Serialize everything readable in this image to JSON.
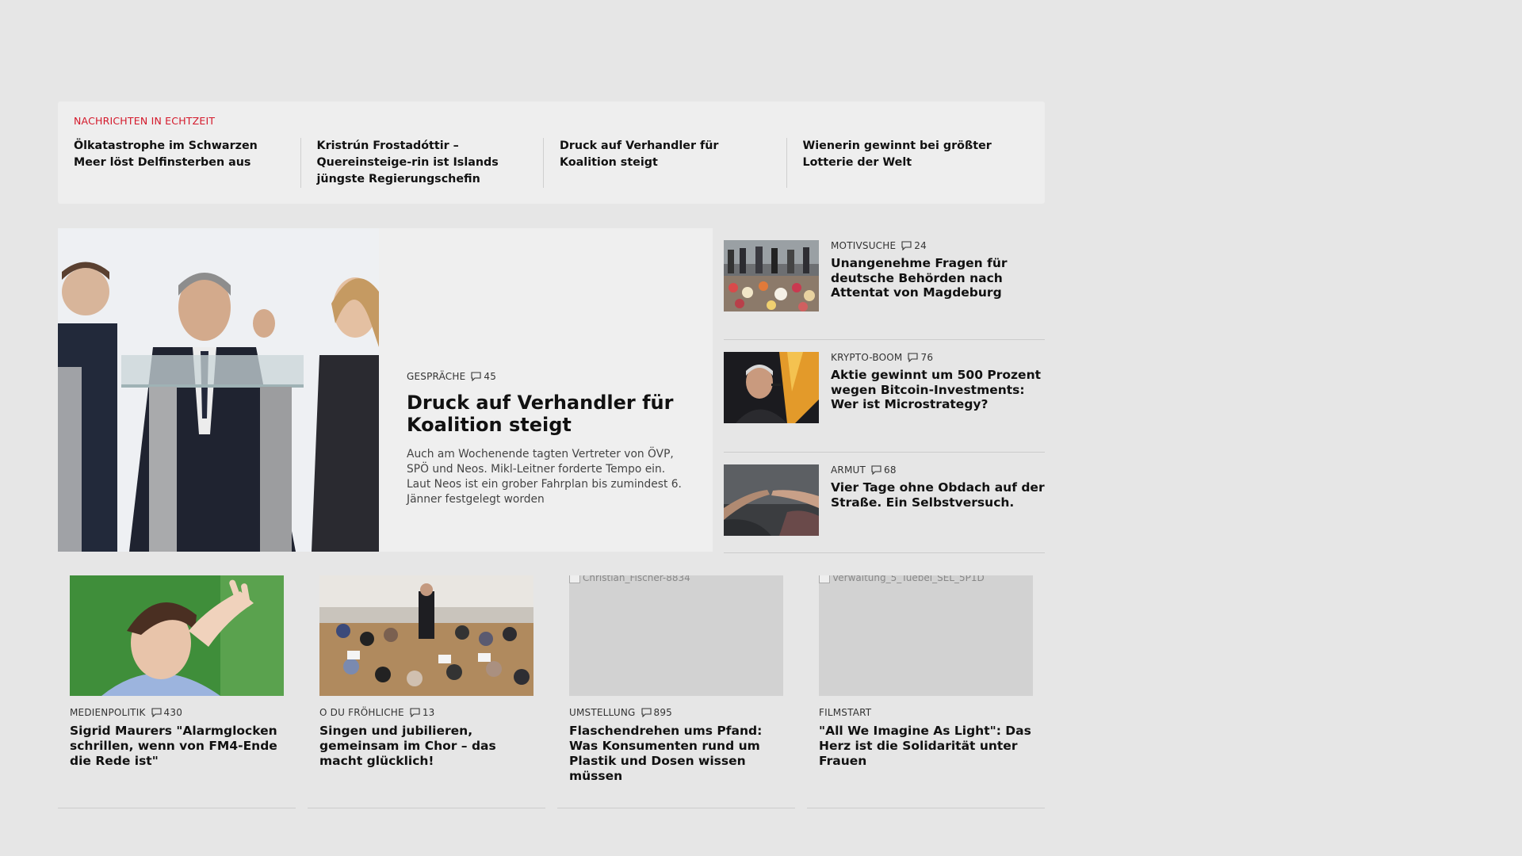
{
  "ticker": {
    "label": "NACHRICHTEN IN ECHTZEIT",
    "items": [
      "Ölkatastrophe im Schwarzen Meer löst Delfinsterben aus",
      "Kristrún Frostadóttir – Quereinsteige-rin ist Islands jüngste Regierungschefin",
      "Druck auf Verhandler für Koalition steigt",
      "Wienerin gewinnt bei größter Lotterie der Welt"
    ]
  },
  "hero": {
    "kicker": "GESPRÄCHE",
    "comments": "45",
    "title": "Druck auf Verhandler für Koalition steigt",
    "lead": "Auch am Wochenende tagten Vertreter von ÖVP, SPÖ und Neos. Mikl-Leitner forderte Tempo ein. Laut Neos ist ein grober Fahrplan bis zumindest 6. Jänner festgelegt worden"
  },
  "side": [
    {
      "kicker": "MOTIVSUCHE",
      "comments": "24",
      "title": "Unangenehme Fragen für deutsche Behörden nach Attentat von Magdeburg"
    },
    {
      "kicker": "KRYPTO-BOOM",
      "comments": "76",
      "title": "Aktie gewinnt um 500 Prozent wegen Bitcoin-Investments: Wer ist Microstrategy?"
    },
    {
      "kicker": "ARMUT",
      "comments": "68",
      "title": "Vier Tage ohne Obdach auf der Straße. Ein Selbstversuch."
    }
  ],
  "cards": [
    {
      "kicker": "MEDIENPOLITIK",
      "comments": "430",
      "title": "Sigrid Maurers \"Alarmglocken schrillen, wenn von FM4-Ende die Rede ist\""
    },
    {
      "kicker": "O DU FRÖHLICHE",
      "comments": "13",
      "title": "Singen und jubilieren, gemeinsam im Chor – das macht glücklich!"
    },
    {
      "kicker": "UMSTELLUNG",
      "comments": "895",
      "title": "Flaschendrehen ums Pfand: Was Konsumenten rund um Plastik und Dosen wissen müssen",
      "img_alt": "Christian_Fischer-8834"
    },
    {
      "kicker": "FILMSTART",
      "comments": "",
      "title": "\"All We Imagine As Light\": Das Herz ist die Solidarität unter Frauen",
      "img_alt": "Verwaltung_5_Tuebel_SEL_5P1D"
    }
  ],
  "colors": {
    "accent": "#d4182a",
    "background": "#e6e6e6",
    "panel": "#efefef"
  }
}
